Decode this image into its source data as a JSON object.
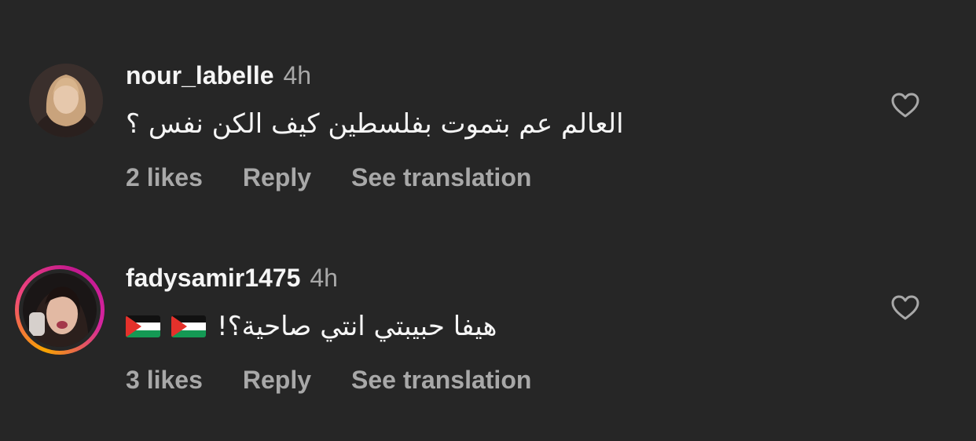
{
  "comments": [
    {
      "username": "nour_labelle",
      "time": "4h",
      "text": "العالم عم بتموت بفلسطين كيف الكن نفس ؟",
      "likes": "2 likes",
      "reply": "Reply",
      "translation": "See translation",
      "has_story_ring": false
    },
    {
      "username": "fadysamir1475",
      "time": "4h",
      "text": "هيفا حبيبتي انتي صاحية؟!",
      "flags": [
        "palestine-flag",
        "palestine-flag"
      ],
      "likes": "3 likes",
      "reply": "Reply",
      "translation": "See translation",
      "has_story_ring": true
    }
  ],
  "colors": {
    "background": "#262626",
    "primary_text": "#f5f5f5",
    "secondary_text": "#a8a8a8"
  },
  "icons": {
    "like": "heart-outline-icon"
  }
}
